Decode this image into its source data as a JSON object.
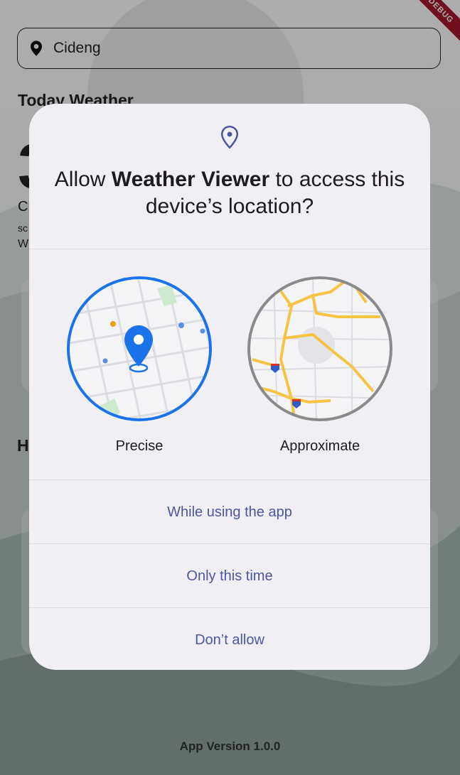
{
  "background": {
    "search": {
      "value": "Cideng",
      "icon": "location-pin-icon"
    },
    "today_title": "Today Weather",
    "temp_fragment": "3",
    "city_fragment": "C",
    "desc_fragment": "sc",
    "wind_fragment": "W",
    "hourly_fragment": "H",
    "app_version": "App Version 1.0.0",
    "debug_banner": "DEBUG"
  },
  "dialog": {
    "icon": "location-pin-icon",
    "title_prefix": "Allow ",
    "app_name": "Weather Viewer",
    "title_suffix": " to access this device’s location?",
    "options": [
      {
        "label": "Precise",
        "icon": "precise-map-icon",
        "selected": true
      },
      {
        "label": "Approximate",
        "icon": "approximate-map-icon",
        "selected": false
      }
    ],
    "actions": [
      {
        "label": "While using the app"
      },
      {
        "label": "Only this time"
      },
      {
        "label": "Don’t allow"
      }
    ]
  },
  "colors": {
    "accent": "#4a56a0",
    "precise_ring": "#1a73e8",
    "approx_ring": "#8a8a8a",
    "dialog_bg": "#f2eff4",
    "road_yellow": "#f6c343"
  }
}
